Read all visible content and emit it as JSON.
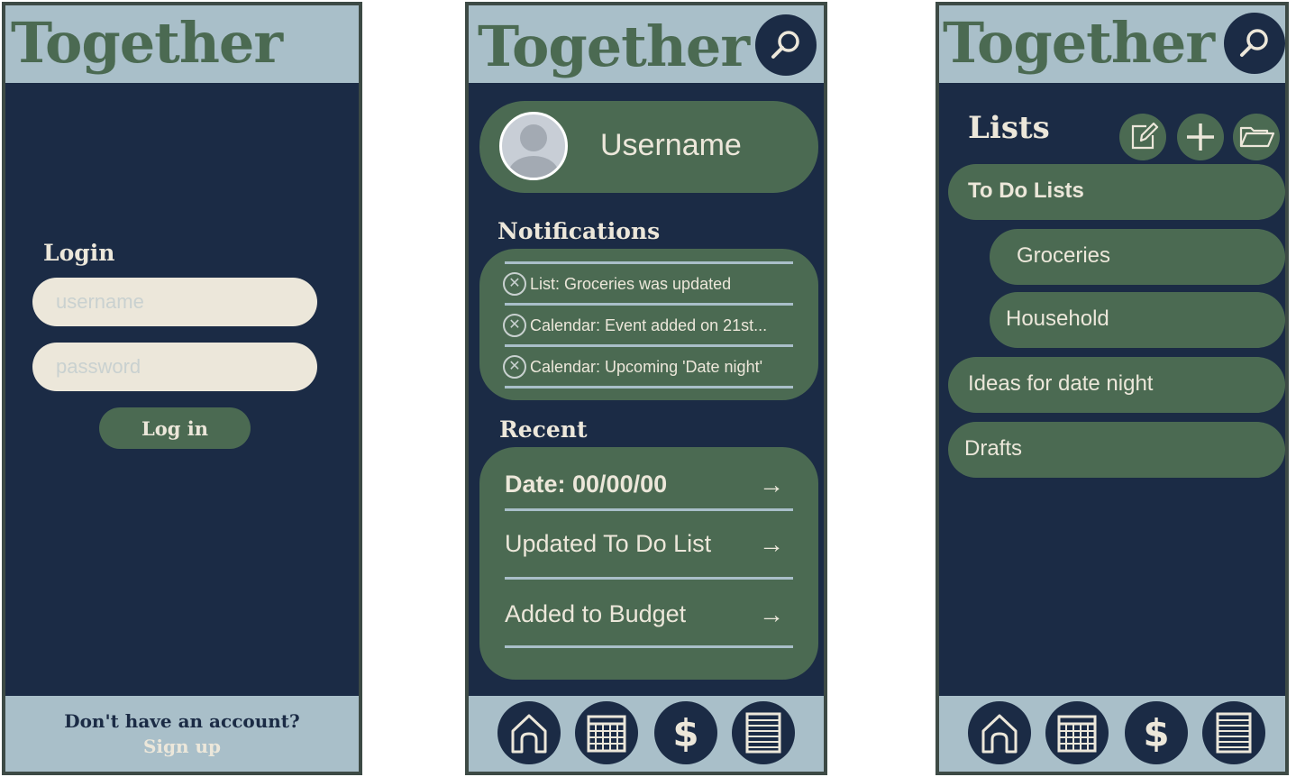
{
  "brand": "Together",
  "login": {
    "title": "Login",
    "username_placeholder": "username",
    "password_placeholder": "password",
    "login_button": "Log in",
    "footer_question": "Don't have an account?",
    "signup_link": "Sign up"
  },
  "home": {
    "username": "Username",
    "notifications_title": "Notifications",
    "notifications": [
      "List: Groceries was updated",
      "Calendar: Event added on 21st...",
      "Calendar: Upcoming 'Date night'"
    ],
    "recent_title": "Recent",
    "recent": [
      {
        "label": "Date: 00/00/00",
        "arrow": "→"
      },
      {
        "label": "Updated To Do List",
        "arrow": "→"
      },
      {
        "label": "Added to Budget",
        "arrow": "→"
      }
    ]
  },
  "lists": {
    "title": "Lists",
    "items": [
      {
        "label": "To Do Lists"
      },
      {
        "label": "Groceries"
      },
      {
        "label": "Household"
      },
      {
        "label": "Ideas for date night"
      },
      {
        "label": "Drafts"
      }
    ]
  },
  "nav": {
    "icons": [
      "home-icon",
      "calendar-icon",
      "budget-icon",
      "list-icon"
    ],
    "budget_symbol": "$"
  },
  "icons": {
    "search": "search-icon",
    "notification_dismiss": "close-circle-icon",
    "lists_tools": [
      "edit-icon",
      "plus-icon",
      "folder-icon"
    ]
  },
  "colors": {
    "navy": "#1b2b45",
    "header_blue": "#a9bfc9",
    "green": "#4b6a52",
    "cream": "#ece7da"
  }
}
